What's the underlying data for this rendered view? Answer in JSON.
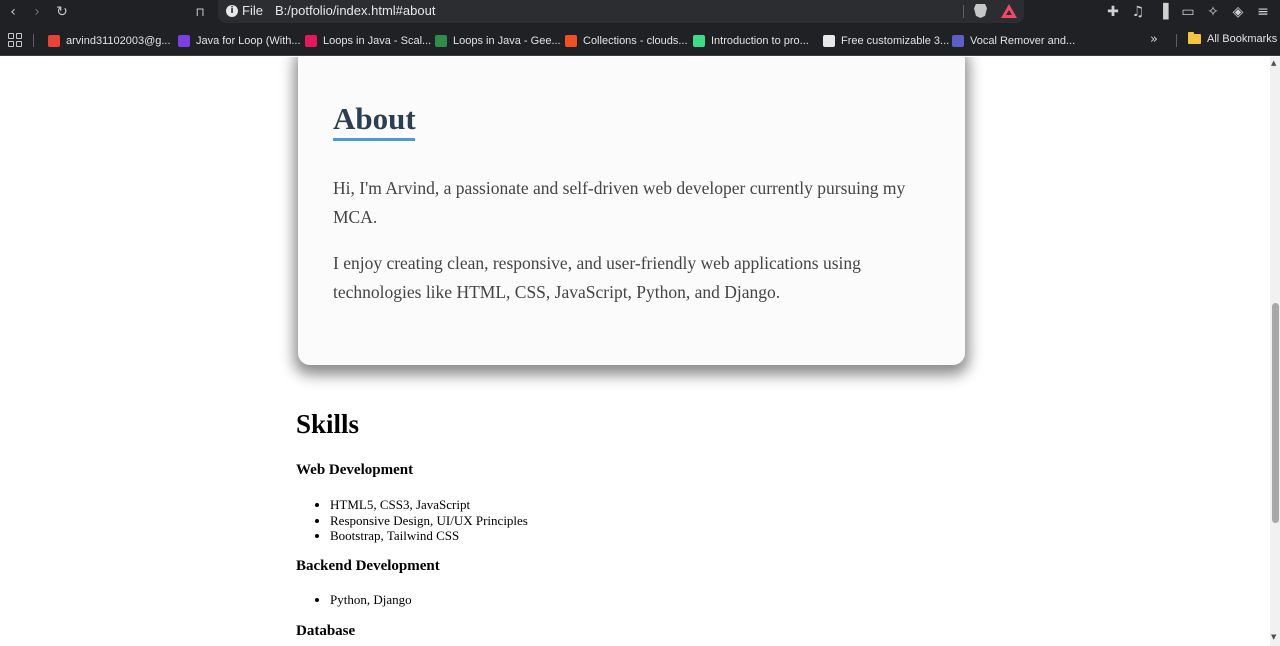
{
  "browser": {
    "url_scheme": "File",
    "url": "B:/potfolio/index.html#about",
    "bookmarks": [
      {
        "label": "arvind31102003@g...",
        "color": "#ea4335"
      },
      {
        "label": "Java for Loop (With...",
        "color": "#7b3fe4"
      },
      {
        "label": "Loops in Java - Scal...",
        "color": "#e8175d"
      },
      {
        "label": "Loops in Java - Gee...",
        "color": "#2f8d46"
      },
      {
        "label": "Collections - clouds...",
        "color": "#f25022"
      },
      {
        "label": "Introduction to pro...",
        "color": "#3ddc84"
      },
      {
        "label": "Free customizable 3...",
        "color": "#e8e8e8"
      },
      {
        "label": "Vocal Remover and...",
        "color": "#5b5fc7"
      }
    ],
    "all_bookmarks_label": "All Bookmarks"
  },
  "about": {
    "title": "About",
    "paragraphs": [
      "Hi, I'm Arvind, a passionate and self-driven web developer currently pursuing my MCA.",
      "I enjoy creating clean, responsive, and user-friendly web applications using technologies like HTML, CSS, JavaScript, Python, and Django."
    ]
  },
  "skills": {
    "title": "Skills",
    "categories": [
      {
        "name": "Web Development",
        "items": [
          "HTML5, CSS3, JavaScript",
          "Responsive Design, UI/UX Principles",
          "Bootstrap, Tailwind CSS"
        ]
      },
      {
        "name": "Backend Development",
        "items": [
          "Python, Django"
        ]
      },
      {
        "name": "Database",
        "items": []
      }
    ]
  }
}
